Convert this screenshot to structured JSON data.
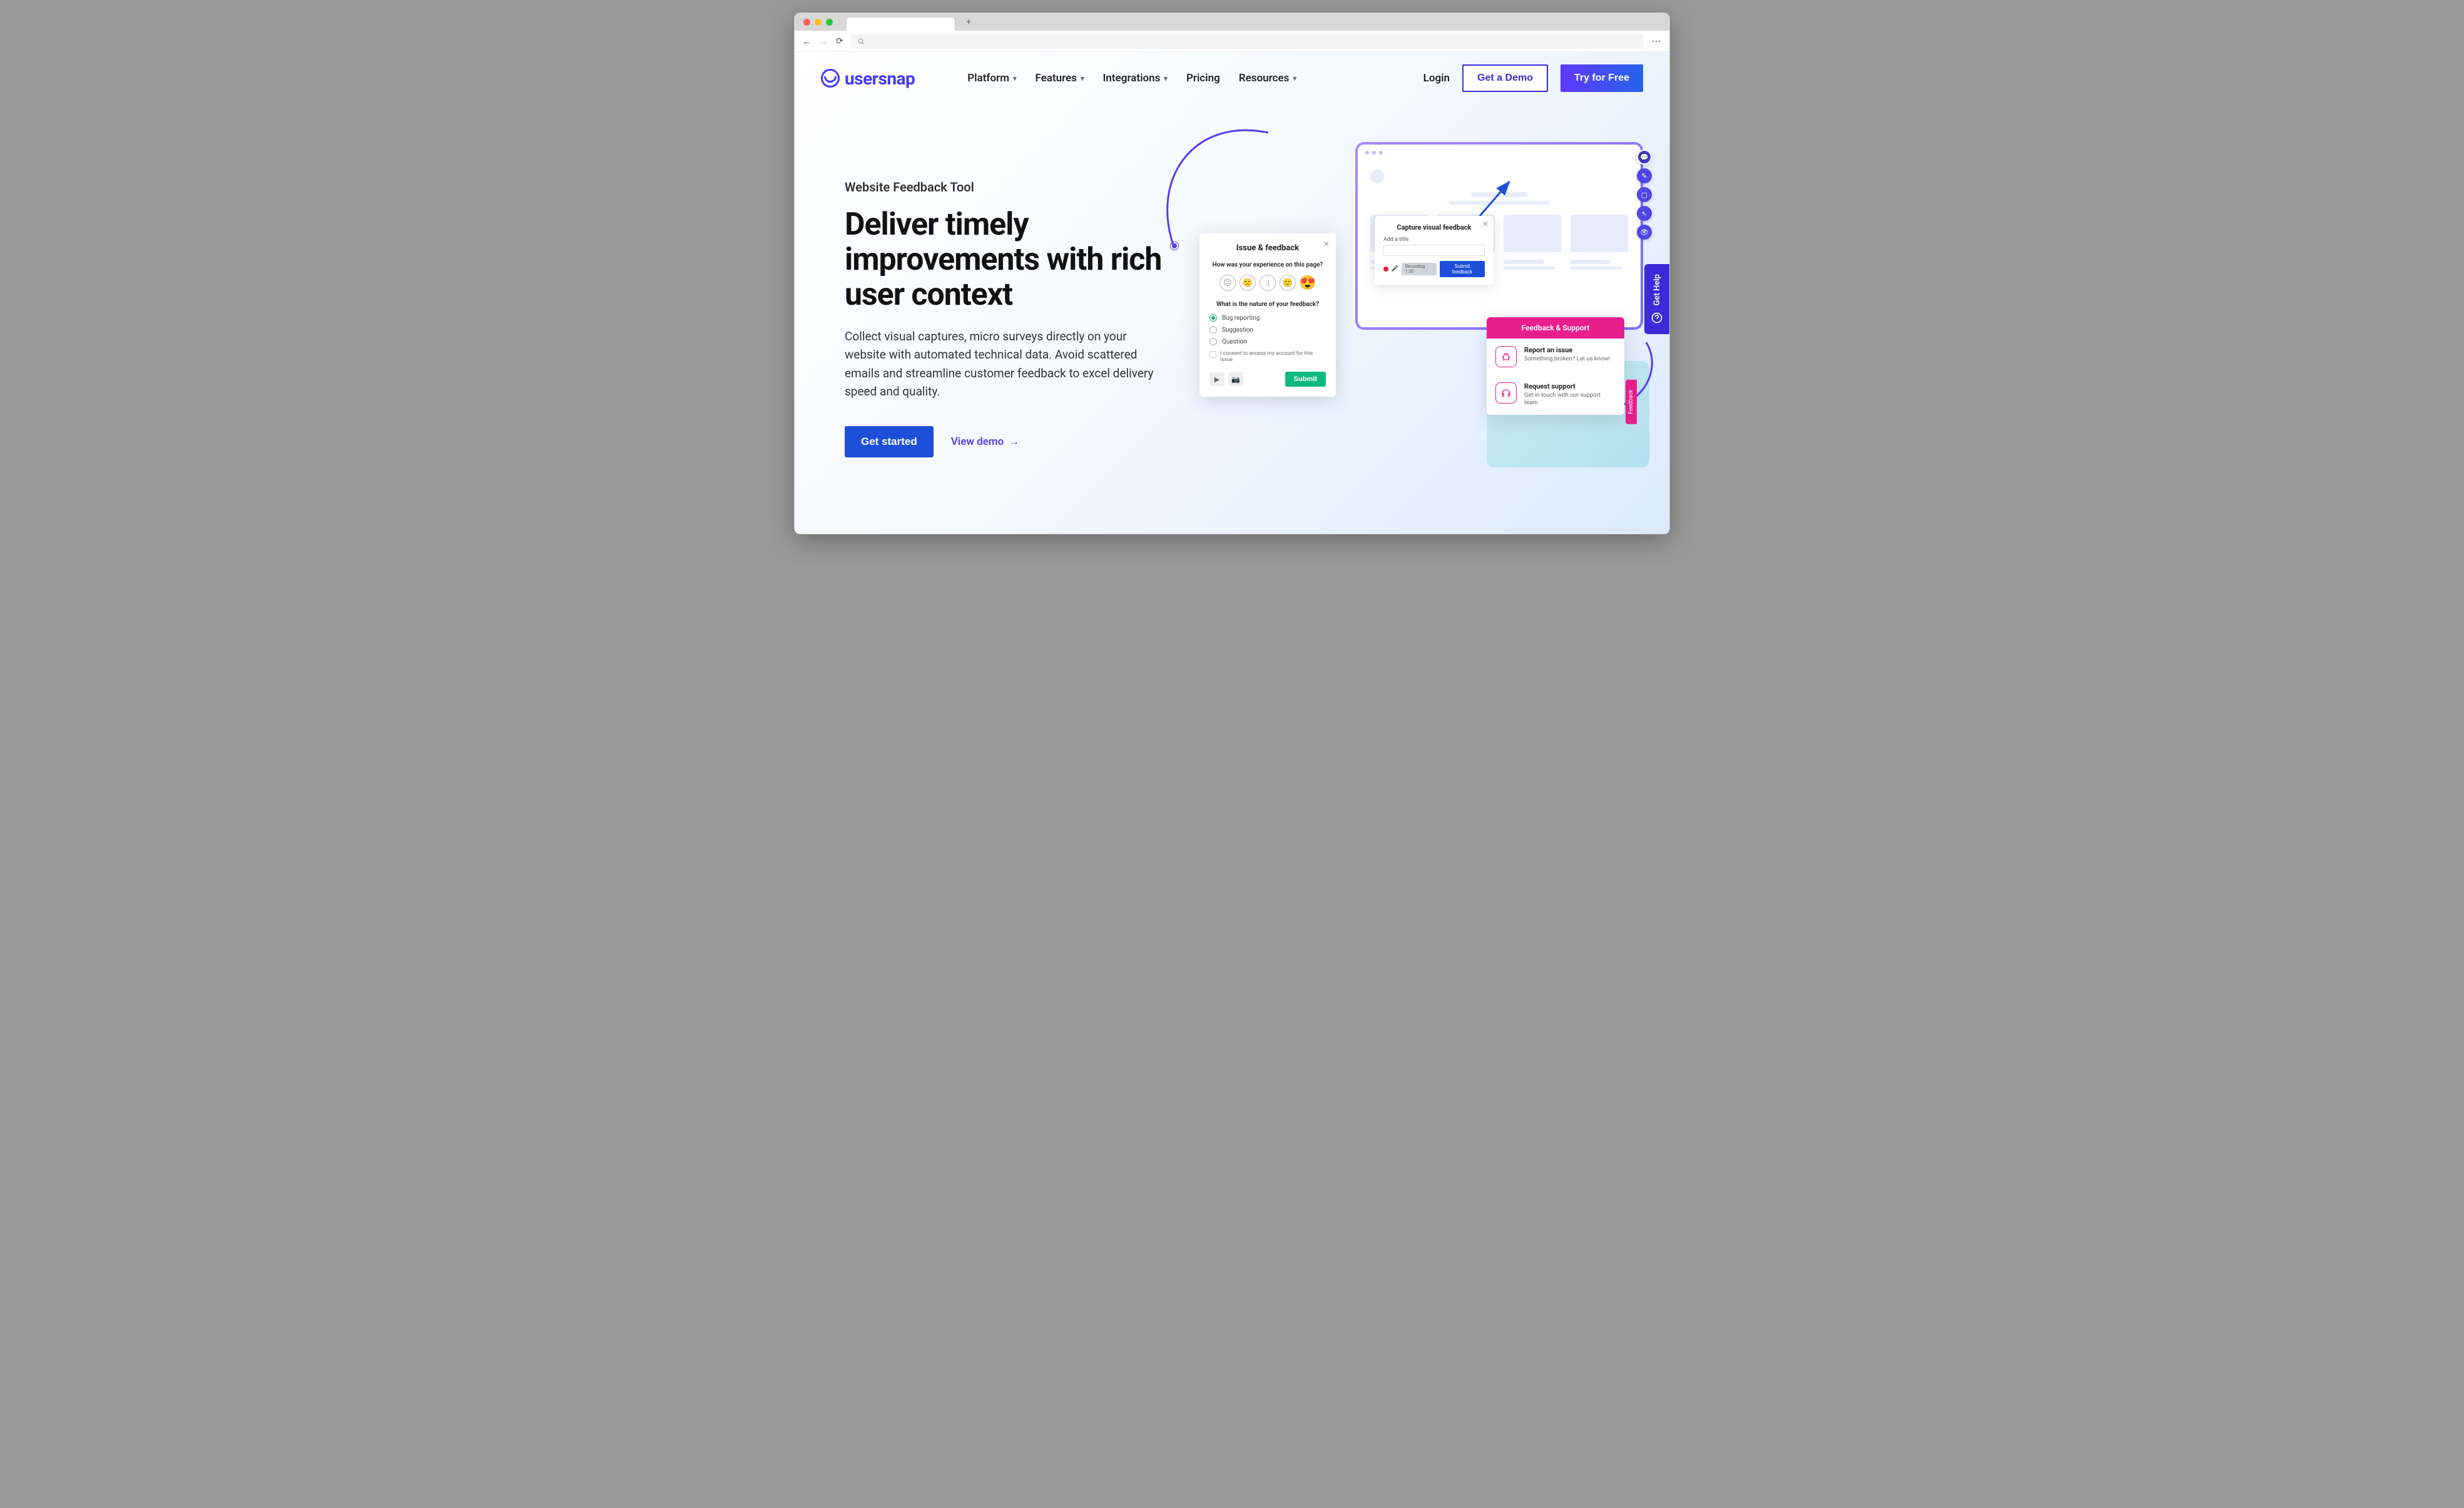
{
  "browser": {
    "new_tab_icon": "+"
  },
  "header": {
    "logo_text": "usersnap",
    "nav": [
      {
        "label": "Platform",
        "has_dropdown": true
      },
      {
        "label": "Features",
        "has_dropdown": true
      },
      {
        "label": "Integrations",
        "has_dropdown": true
      },
      {
        "label": "Pricing",
        "has_dropdown": false
      },
      {
        "label": "Resources",
        "has_dropdown": true
      }
    ],
    "login": "Login",
    "demo_button": "Get a Demo",
    "trial_button": "Try for Free"
  },
  "hero": {
    "eyebrow": "Website Feedback Tool",
    "title": "Deliver timely improvements with rich user context",
    "description": "Collect visual captures, micro surveys directly on your website with automated technical data. Avoid scattered emails and streamline customer feedback to excel delivery speed and quality.",
    "cta_primary": "Get started",
    "cta_secondary": "View demo"
  },
  "mockup": {
    "capture_popup": {
      "title": "Capture visual feedback",
      "field_label": "Add a title",
      "recording_chip": "Recording 1:35",
      "submit": "Submit feedback"
    },
    "issue_popup": {
      "title": "Issue & feedback",
      "question1": "How was your experience on this page?",
      "question2": "What is the nature of your feedback?",
      "options": [
        "Bug reporting",
        "Suggestion",
        "Question"
      ],
      "selected_option": "Bug reporting",
      "consent": "I consent to access my account for this issue",
      "submit": "Submit"
    },
    "support_popup": {
      "header": "Feedback & Support",
      "items": [
        {
          "title": "Report an issue",
          "desc": "Something broken? Let us know!"
        },
        {
          "title": "Request support",
          "desc": "Get in touch with our support team."
        }
      ]
    },
    "feedback_tab": "Feedback"
  },
  "help_tab": "Get Help"
}
